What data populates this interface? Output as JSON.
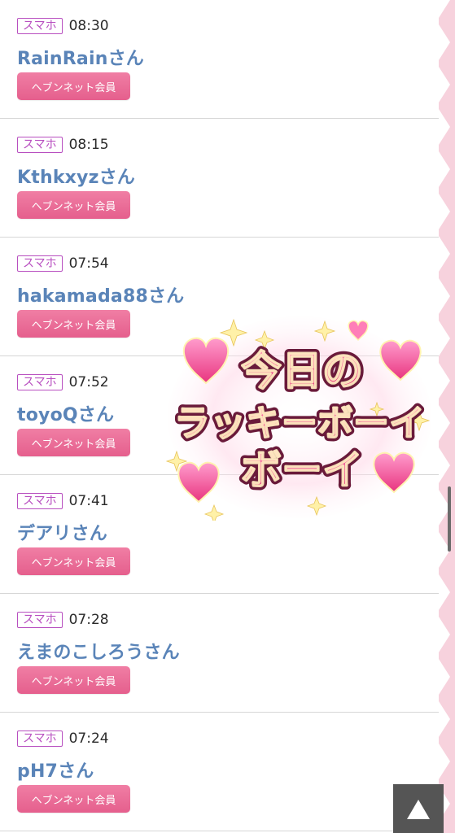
{
  "entries": [
    {
      "device": "スマホ",
      "time": "08:30",
      "name": "RainRainさん",
      "badge": "ヘブンネット会員"
    },
    {
      "device": "スマホ",
      "time": "08:15",
      "name": "Kthkxyzさん",
      "badge": "ヘブンネット会員"
    },
    {
      "device": "スマホ",
      "time": "07:54",
      "name": "hakamada88さん",
      "badge": "ヘブンネット会員"
    },
    {
      "device": "スマホ",
      "time": "07:52",
      "name": "toyoQさん",
      "badge": "ヘブンネット会員"
    },
    {
      "device": "スマホ",
      "time": "07:41",
      "name": "デアリさん",
      "badge": "ヘブンネット会員"
    },
    {
      "device": "スマホ",
      "time": "07:28",
      "name": "えまのこしろうさん",
      "badge": "ヘブンネット会員"
    },
    {
      "device": "スマホ",
      "time": "07:24",
      "name": "pH7さん",
      "badge": "ヘブンネット会員"
    }
  ],
  "stamp": {
    "line1": "今日の",
    "line2": "ラッキーボーイ",
    "line3": "ボーイ"
  },
  "colors": {
    "device_badge": "#b84fc0",
    "user_name": "#5a84b8",
    "member_badge": "#e55f8d",
    "stamp_fill": "#e8357f",
    "stamp_outline": "#6a1a3a"
  },
  "icons": {
    "back_to_top": "triangle-up-icon"
  }
}
